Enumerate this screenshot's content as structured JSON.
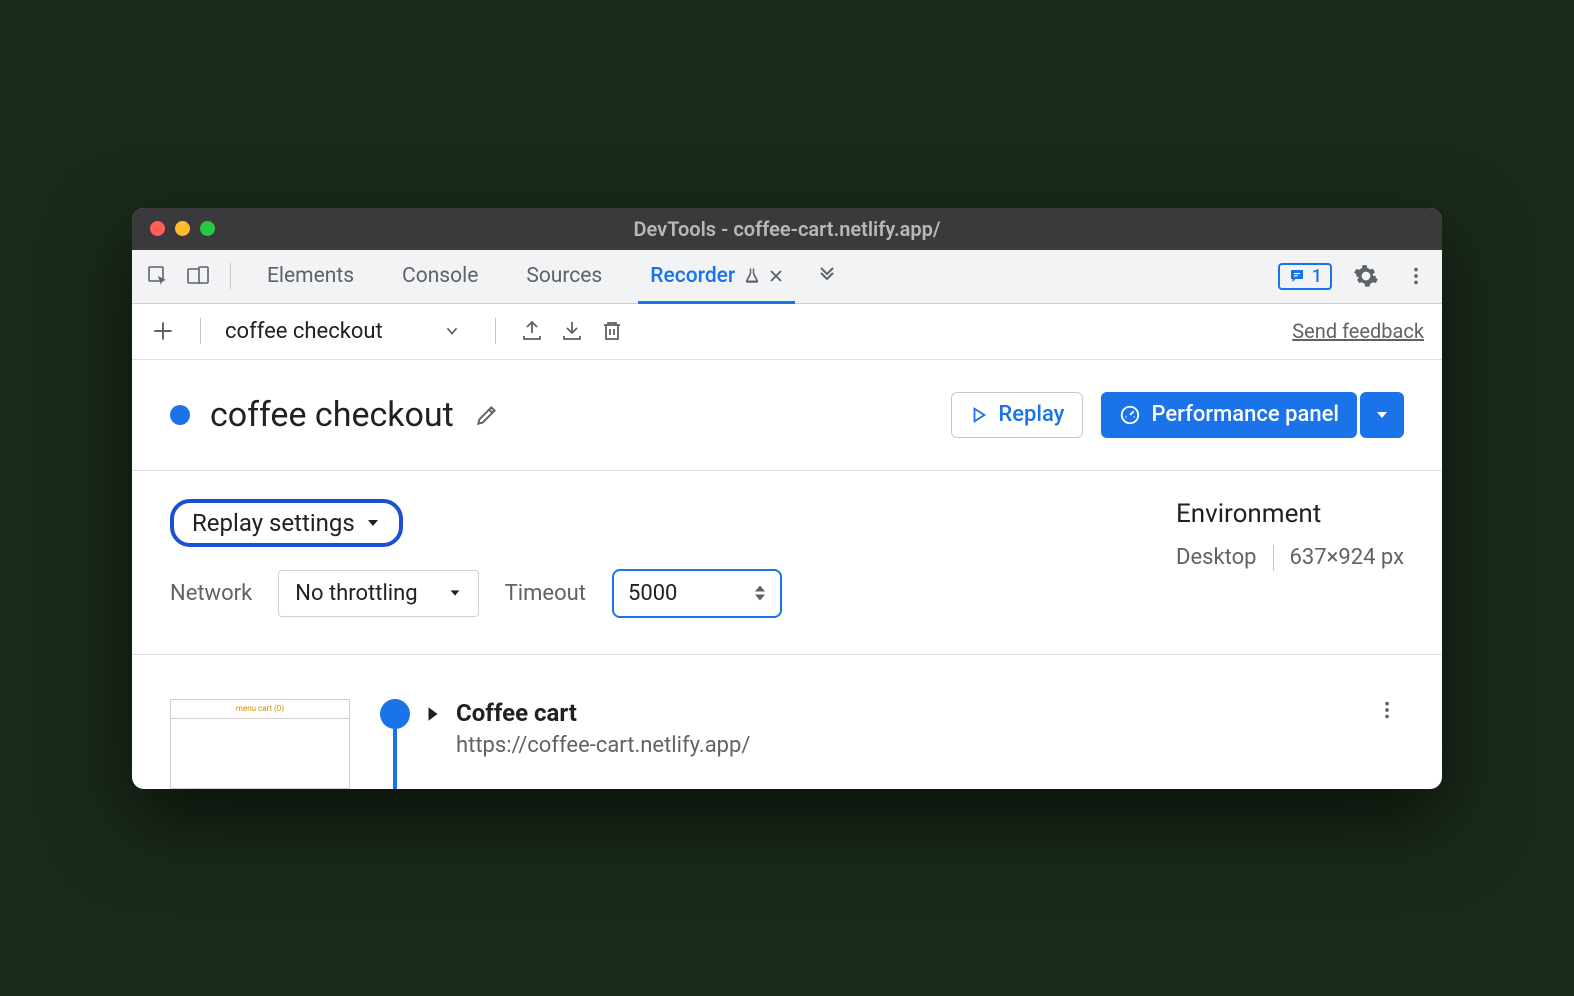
{
  "window": {
    "title": "DevTools - coffee-cart.netlify.app/"
  },
  "tabs": {
    "items": [
      "Elements",
      "Console",
      "Sources",
      "Recorder"
    ],
    "active": "Recorder",
    "issues_count": "1"
  },
  "toolbar": {
    "recording_selected": "coffee checkout",
    "feedback_link": "Send feedback"
  },
  "header": {
    "title": "coffee checkout",
    "replay_label": "Replay",
    "perf_label": "Performance panel"
  },
  "settings": {
    "toggle_label": "Replay settings",
    "network_label": "Network",
    "network_value": "No throttling",
    "timeout_label": "Timeout",
    "timeout_value": "5000",
    "env_label": "Environment",
    "env_device": "Desktop",
    "env_viewport": "637×924 px"
  },
  "step": {
    "title": "Coffee cart",
    "url": "https://coffee-cart.netlify.app/",
    "thumb_label": "menu  cart (0)"
  }
}
